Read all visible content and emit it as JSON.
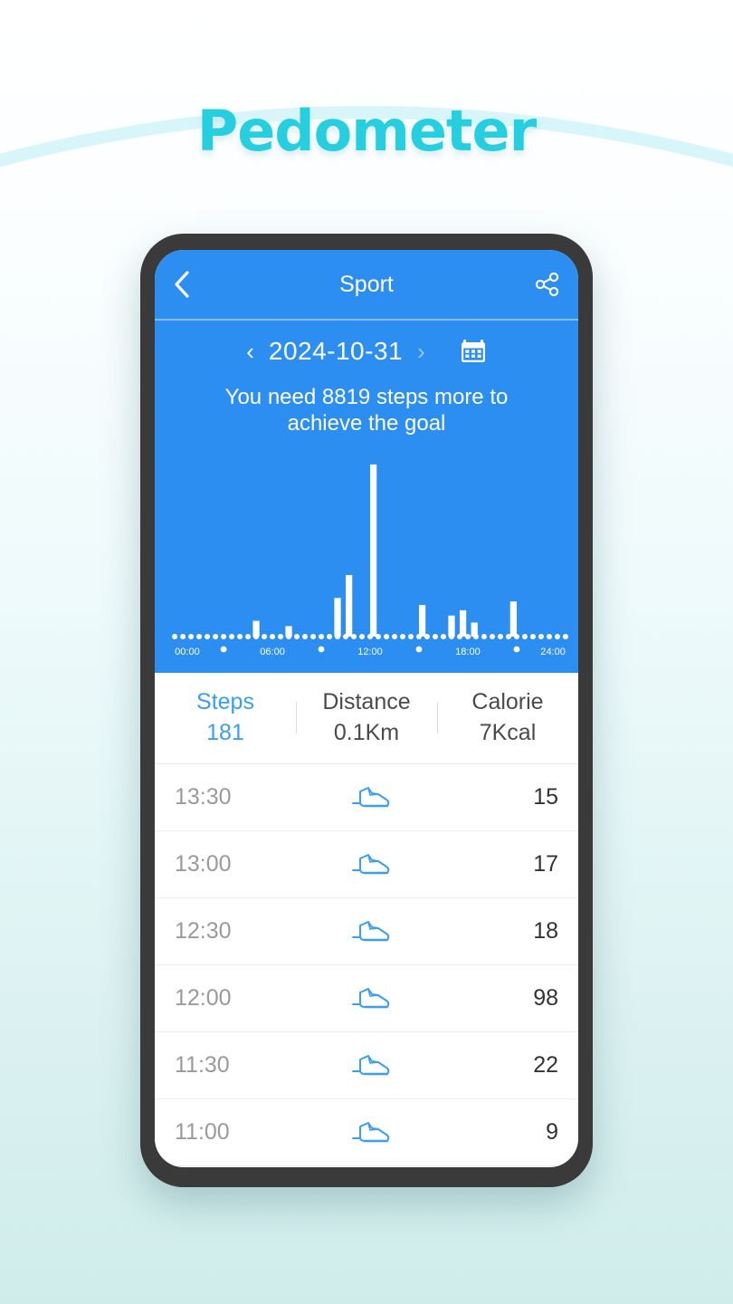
{
  "page": {
    "title": "Pedometer",
    "title_color": "#25cfe0",
    "background_top": "#ffffff",
    "background_bottom": "#cfeceb",
    "arc_color": "#d8f6fa"
  },
  "app": {
    "accent": "#2b8ef0",
    "appbar": {
      "back_icon": "chevron-left-icon",
      "title": "Sport",
      "share_icon": "share-icon"
    },
    "datebar": {
      "prev_icon": "chevron-left-icon",
      "date": "2024-10-31",
      "next_icon": "chevron-right-icon",
      "next_disabled": true,
      "calendar_icon": "calendar-icon"
    },
    "goal_text": "You need 8819 steps more to achieve the goal",
    "stats": [
      {
        "key": "Steps",
        "value": "181",
        "active": true
      },
      {
        "key": "Distance",
        "value": "0.1Km",
        "active": false
      },
      {
        "key": "Calorie",
        "value": "7Kcal",
        "active": false
      }
    ],
    "list": [
      {
        "time": "13:30",
        "icon": "running-shoe-icon",
        "count": "15"
      },
      {
        "time": "13:00",
        "icon": "running-shoe-icon",
        "count": "17"
      },
      {
        "time": "12:30",
        "icon": "running-shoe-icon",
        "count": "18"
      },
      {
        "time": "12:00",
        "icon": "running-shoe-icon",
        "count": "98"
      },
      {
        "time": "11:30",
        "icon": "running-shoe-icon",
        "count": "22"
      },
      {
        "time": "11:00",
        "icon": "running-shoe-icon",
        "count": "9"
      }
    ]
  },
  "chart_data": {
    "type": "bar",
    "title": "",
    "xlabel": "",
    "ylabel": "",
    "grid": false,
    "legend": false,
    "bar_color": "#ffffff",
    "baseline_dot_color": "#ffffff",
    "tick_labels": [
      "00:00",
      "06:00",
      "12:00",
      "18:00",
      "24:00"
    ],
    "tick_positions": [
      0,
      6,
      12,
      18,
      24
    ],
    "xlim": [
      0,
      24
    ],
    "ylim": [
      0,
      100
    ],
    "x_unit": "hour",
    "bin_minutes": 30,
    "x": [
      0,
      0.5,
      1,
      1.5,
      2,
      2.5,
      3,
      3.5,
      4,
      4.5,
      5,
      5.5,
      6,
      6.5,
      7,
      7.5,
      8,
      8.5,
      9,
      9.5,
      10,
      10.5,
      11,
      11.5,
      12,
      12.5,
      13,
      13.5,
      14,
      14.5,
      15,
      15.5,
      16,
      16.5,
      17,
      17.5,
      18,
      18.5,
      19,
      19.5,
      20,
      20.5,
      21,
      21.5,
      22,
      22.5,
      23,
      23.5,
      24
    ],
    "values": [
      0,
      0,
      0,
      0,
      0,
      0,
      0,
      0,
      0,
      0,
      0,
      0,
      0,
      0,
      0,
      0,
      0,
      0,
      0,
      0,
      0,
      0,
      0,
      0,
      0,
      0,
      0,
      0,
      0,
      0,
      0,
      0,
      0,
      0,
      0,
      0,
      0,
      0,
      0,
      0,
      0,
      0,
      0,
      0,
      0,
      0,
      0,
      0,
      0
    ],
    "bars": [
      {
        "time": "05:00",
        "x": 5.0,
        "value": 9
      },
      {
        "time": "07:00",
        "x": 7.0,
        "value": 6
      },
      {
        "time": "10:00",
        "x": 10.0,
        "value": 22
      },
      {
        "time": "10:30",
        "x": 10.7,
        "value": 35
      },
      {
        "time": "12:00",
        "x": 12.2,
        "value": 98
      },
      {
        "time": "15:00",
        "x": 15.2,
        "value": 18
      },
      {
        "time": "17:00",
        "x": 17.0,
        "value": 12
      },
      {
        "time": "17:30",
        "x": 17.7,
        "value": 15
      },
      {
        "time": "18:30",
        "x": 18.4,
        "value": 8
      },
      {
        "time": "21:00",
        "x": 20.8,
        "value": 20
      }
    ]
  }
}
